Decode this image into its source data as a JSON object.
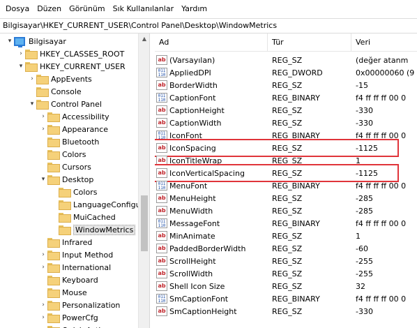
{
  "menubar": [
    "Dosya",
    "Düzen",
    "Görünüm",
    "Sık Kullanılanlar",
    "Yardım"
  ],
  "address": "Bilgisayar\\HKEY_CURRENT_USER\\Control Panel\\Desktop\\WindowMetrics",
  "tree": [
    {
      "label": "Bilgisayar",
      "exp": "▾",
      "icon": "computer-icon",
      "level": 0
    },
    {
      "label": "HKEY_CLASSES_ROOT",
      "exp": "›",
      "icon": "folder-icon",
      "level": 1
    },
    {
      "label": "HKEY_CURRENT_USER",
      "exp": "▾",
      "icon": "folder-icon",
      "level": 1
    },
    {
      "label": "AppEvents",
      "exp": "›",
      "icon": "folder-icon",
      "level": 2
    },
    {
      "label": "Console",
      "exp": "",
      "icon": "folder-icon",
      "level": 2
    },
    {
      "label": "Control Panel",
      "exp": "▾",
      "icon": "folder-icon",
      "level": 2
    },
    {
      "label": "Accessibility",
      "exp": "›",
      "icon": "folder-icon",
      "level": 3
    },
    {
      "label": "Appearance",
      "exp": "›",
      "icon": "folder-icon",
      "level": 3
    },
    {
      "label": "Bluetooth",
      "exp": "",
      "icon": "folder-icon",
      "level": 3
    },
    {
      "label": "Colors",
      "exp": "",
      "icon": "folder-icon",
      "level": 3
    },
    {
      "label": "Cursors",
      "exp": "",
      "icon": "folder-icon",
      "level": 3
    },
    {
      "label": "Desktop",
      "exp": "▾",
      "icon": "folder-icon",
      "level": 3
    },
    {
      "label": "Colors",
      "exp": "",
      "icon": "folder-icon",
      "level": 4
    },
    {
      "label": "LanguageConfigu",
      "exp": "",
      "icon": "folder-icon",
      "level": 4
    },
    {
      "label": "MuiCached",
      "exp": "",
      "icon": "folder-icon",
      "level": 4
    },
    {
      "label": "WindowMetrics",
      "exp": "",
      "icon": "folder-icon",
      "level": 4,
      "selected": true
    },
    {
      "label": "Infrared",
      "exp": "",
      "icon": "folder-icon",
      "level": 3
    },
    {
      "label": "Input Method",
      "exp": "›",
      "icon": "folder-icon",
      "level": 3
    },
    {
      "label": "International",
      "exp": "›",
      "icon": "folder-icon",
      "level": 3
    },
    {
      "label": "Keyboard",
      "exp": "",
      "icon": "folder-icon",
      "level": 3
    },
    {
      "label": "Mouse",
      "exp": "",
      "icon": "folder-icon",
      "level": 3
    },
    {
      "label": "Personalization",
      "exp": "›",
      "icon": "folder-icon",
      "level": 3
    },
    {
      "label": "PowerCfg",
      "exp": "›",
      "icon": "folder-icon",
      "level": 3
    },
    {
      "label": "Quick Actions",
      "exp": "›",
      "icon": "folder-icon",
      "level": 3
    }
  ],
  "columns": {
    "name": "Ad",
    "type": "Tür",
    "data": "Veri"
  },
  "rows": [
    {
      "name": "(Varsayılan)",
      "type": "REG_SZ",
      "data": "(değer atanm",
      "icon": "string-value-icon"
    },
    {
      "name": "AppliedDPI",
      "type": "REG_DWORD",
      "data": "0x00000060 (9",
      "icon": "binary-value-icon"
    },
    {
      "name": "BorderWidth",
      "type": "REG_SZ",
      "data": "-15",
      "icon": "string-value-icon"
    },
    {
      "name": "CaptionFont",
      "type": "REG_BINARY",
      "data": "f4 ff ff ff 00 0",
      "icon": "binary-value-icon"
    },
    {
      "name": "CaptionHeight",
      "type": "REG_SZ",
      "data": "-330",
      "icon": "string-value-icon"
    },
    {
      "name": "CaptionWidth",
      "type": "REG_SZ",
      "data": "-330",
      "icon": "string-value-icon"
    },
    {
      "name": "IconFont",
      "type": "REG_BINARY",
      "data": "f4 ff ff ff 00 0",
      "icon": "binary-value-icon"
    },
    {
      "name": "IconSpacing",
      "type": "REG_SZ",
      "data": "-1125",
      "icon": "string-value-icon",
      "highlight": true
    },
    {
      "name": "IconTitleWrap",
      "type": "REG_SZ",
      "data": "1",
      "icon": "string-value-icon"
    },
    {
      "name": "IconVerticalSpacing",
      "type": "REG_SZ",
      "data": "-1125",
      "icon": "string-value-icon",
      "highlight": true
    },
    {
      "name": "MenuFont",
      "type": "REG_BINARY",
      "data": "f4 ff ff ff 00 0",
      "icon": "binary-value-icon"
    },
    {
      "name": "MenuHeight",
      "type": "REG_SZ",
      "data": "-285",
      "icon": "string-value-icon"
    },
    {
      "name": "MenuWidth",
      "type": "REG_SZ",
      "data": "-285",
      "icon": "string-value-icon"
    },
    {
      "name": "MessageFont",
      "type": "REG_BINARY",
      "data": "f4 ff ff ff 00 0",
      "icon": "binary-value-icon"
    },
    {
      "name": "MinAnimate",
      "type": "REG_SZ",
      "data": "1",
      "icon": "string-value-icon"
    },
    {
      "name": "PaddedBorderWidth",
      "type": "REG_SZ",
      "data": "-60",
      "icon": "string-value-icon"
    },
    {
      "name": "ScrollHeight",
      "type": "REG_SZ",
      "data": "-255",
      "icon": "string-value-icon"
    },
    {
      "name": "ScrollWidth",
      "type": "REG_SZ",
      "data": "-255",
      "icon": "string-value-icon"
    },
    {
      "name": "Shell Icon Size",
      "type": "REG_SZ",
      "data": "32",
      "icon": "string-value-icon"
    },
    {
      "name": "SmCaptionFont",
      "type": "REG_BINARY",
      "data": "f4 ff ff ff 00 0",
      "icon": "binary-value-icon"
    },
    {
      "name": "SmCaptionHeight",
      "type": "REG_SZ",
      "data": "-330",
      "icon": "string-value-icon"
    }
  ],
  "colors": {
    "highlight_border": "#e0343a",
    "selection_bg": "#e5e5e5",
    "folder": "#f5d17a"
  }
}
